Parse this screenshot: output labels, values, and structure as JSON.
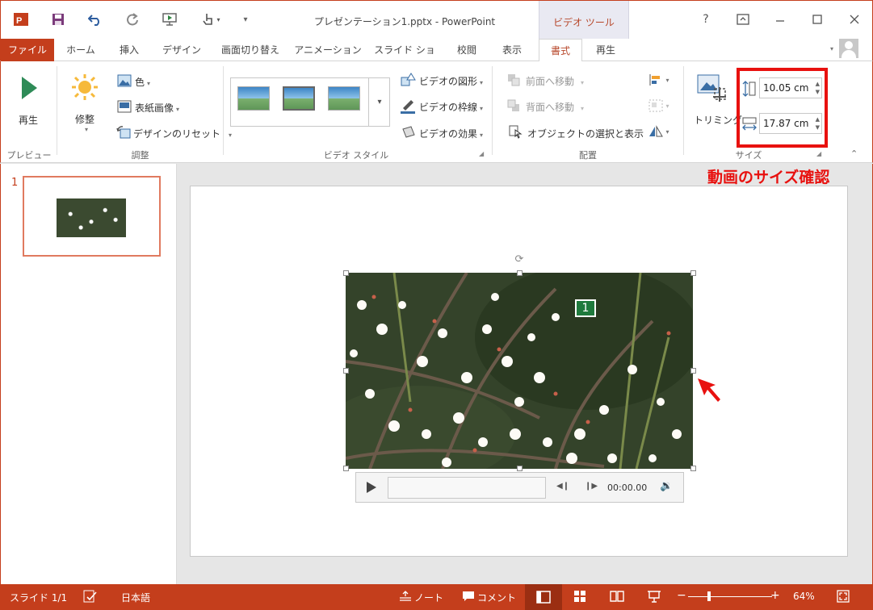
{
  "window": {
    "title": "プレゼンテーション1.pptx - PowerPoint",
    "context_tab_group": "ビデオ ツール"
  },
  "tabs": [
    {
      "label": "ファイル",
      "active": false
    },
    {
      "label": "ホーム",
      "active": false
    },
    {
      "label": "挿入",
      "active": false
    },
    {
      "label": "デザイン",
      "active": false
    },
    {
      "label": "画面切り替え",
      "active": false
    },
    {
      "label": "アニメーション",
      "active": false
    },
    {
      "label": "スライド ショー",
      "active": false
    },
    {
      "label": "校閲",
      "active": false
    },
    {
      "label": "表示",
      "active": false
    },
    {
      "label": "書式",
      "active": true
    },
    {
      "label": "再生",
      "active": false
    }
  ],
  "ribbon": {
    "preview": {
      "play": "再生",
      "group": "プレビュー"
    },
    "adjust": {
      "corrections": "修整",
      "color": "色",
      "poster_frame": "表紙画像",
      "reset_design": "デザインのリセット",
      "group": "調整"
    },
    "video_styles": {
      "shape": "ビデオの図形",
      "border": "ビデオの枠線",
      "effects": "ビデオの効果",
      "group": "ビデオ スタイル"
    },
    "arrange": {
      "bring_forward": "前面へ移動",
      "send_backward": "背面へ移動",
      "selection_pane": "オブジェクトの選択と表示",
      "group": "配置"
    },
    "size": {
      "crop": "トリミング",
      "height": "10.05 cm",
      "width": "17.87 cm",
      "group": "サイズ"
    }
  },
  "slides": [
    {
      "number": "1"
    }
  ],
  "annotation": "動画のサイズ確認",
  "video": {
    "bookmark": "1",
    "time": "00:00.00"
  },
  "status": {
    "slide": "スライド 1/1",
    "language": "日本語",
    "notes": "ノート",
    "comments": "コメント",
    "zoom": "64%"
  },
  "colors": {
    "accent": "#c43e1c",
    "highlight": "#e8110f"
  }
}
